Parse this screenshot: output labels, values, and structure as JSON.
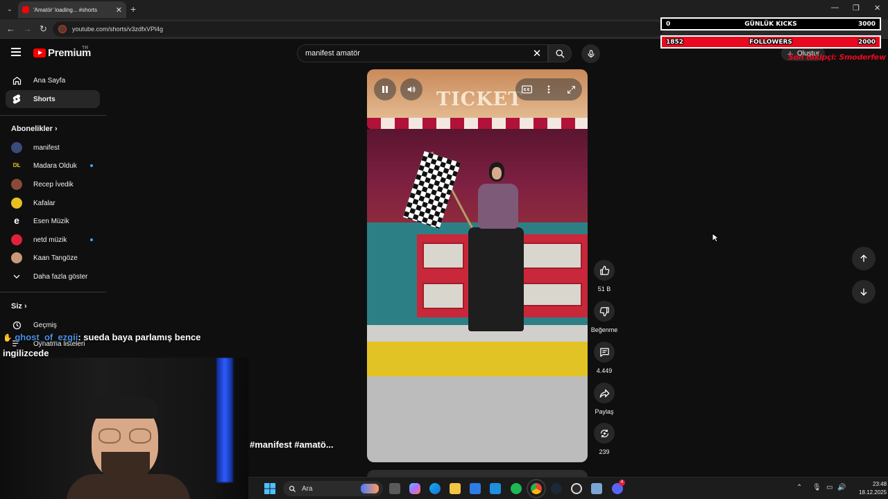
{
  "browser": {
    "tab_title": "'Amatör' loading... #shorts",
    "tab_close": "✕",
    "url": "youtube.com/shorts/v3zdfxVPl4g"
  },
  "header": {
    "logo_text": "Premium",
    "country_code": "TR",
    "search_value": "manifest amatör",
    "create_label": "Oluştur"
  },
  "sidebar": {
    "main": [
      {
        "label": "Ana Sayfa",
        "icon": "home-icon"
      },
      {
        "label": "Shorts",
        "icon": "shorts-icon"
      }
    ],
    "subscriptions_title": "Abonelikler",
    "subscriptions": [
      {
        "label": "manifest",
        "color": "#3a4a7a",
        "new": false
      },
      {
        "label": "Madara Olduk",
        "color": "#111111",
        "new": true
      },
      {
        "label": "Recep İvedik",
        "color": "#8a4a3a",
        "new": false
      },
      {
        "label": "Kafalar",
        "color": "#e8c020",
        "new": false
      },
      {
        "label": "Esen Müzik",
        "color": "#0f0f0f",
        "new": false
      },
      {
        "label": "netd müzik",
        "color": "#e0213a",
        "new": true
      },
      {
        "label": "Kaan Tangöze",
        "color": "#c89a7a",
        "new": false
      }
    ],
    "show_more_label": "Daha fazla göster",
    "you_title": "Siz",
    "you_items": [
      {
        "label": "Geçmiş"
      },
      {
        "label": "Oynatma listeleri"
      }
    ]
  },
  "video": {
    "sign_text": "TICKET",
    "hashtags": "#manifest #amatö..."
  },
  "actions": {
    "like_count": "51 B",
    "dislike_label": "Beğenme",
    "comment_count": "4.449",
    "share_label": "Paylaş",
    "remix_count": "239"
  },
  "overlay": {
    "kicks_left": "0",
    "kicks_label": "GÜNLÜK KICKS",
    "kicks_goal": "3000",
    "followers_left": "1852",
    "followers_label": "FOLLOWERS",
    "followers_goal": "2000",
    "last_follower": "Son takipçi: Smoderfew",
    "chat_user": "ghost_of_ezgii",
    "chat_text": ": sueda baya parlamış bence ingilizcede"
  },
  "taskbar": {
    "search_label": "Ara",
    "time": "23:48",
    "date": "18.12.2025",
    "discord_badge": "4"
  },
  "colors": {
    "yt_red": "#ff0000",
    "accent_blue": "#3ea6ff",
    "kick_red": "#e8091e"
  }
}
